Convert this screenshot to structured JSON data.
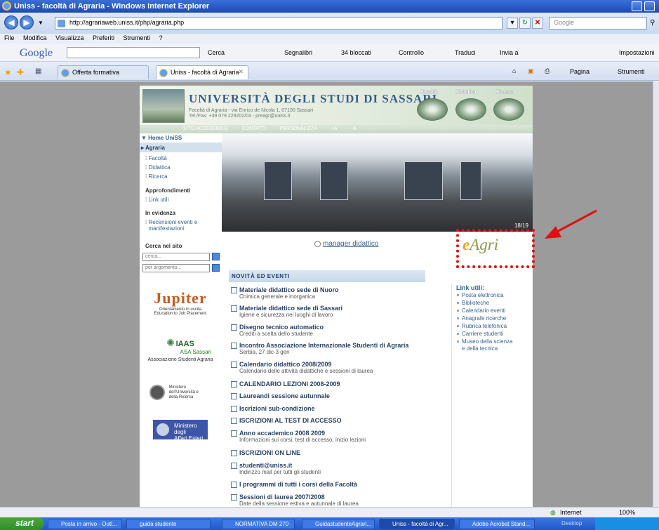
{
  "window": {
    "title": "Uniss - facoltà di Agraria - Windows Internet Explorer"
  },
  "address": {
    "url": "http://agrariaweb.uniss.it/php/agraria.php",
    "search_placeholder": "Google"
  },
  "menu": [
    "File",
    "Modifica",
    "Visualizza",
    "Preferiti",
    "Strumenti",
    "?"
  ],
  "googlebar": {
    "logo": "Google",
    "items": [
      "Cerca",
      "Segnalibri",
      "34 bloccati",
      "Controllo",
      "Traduci",
      "Invia a"
    ],
    "settings": "Impostazioni"
  },
  "tabs": {
    "favorite": "Offerta formativa",
    "active": "Uniss - facoltà di Agraria"
  },
  "commandbar": {
    "page": "Pagina",
    "tools": "Strumenti"
  },
  "site": {
    "university": "UNIVERSITÀ DEGLI STUDI DI SASSARI",
    "faculty_line1": "Facoltà di Agraria - via Enrico de Nicola 1, 07100 Sassari",
    "faculty_line2": "Tel./Fax: +39 079 229202/03 - preagr@uniss.it",
    "top_nav": [
      "Facoltà",
      "Didattica",
      "Ricerca"
    ],
    "access_bar": [
      "SITO ACCESSIBILE",
      "CONTATTI",
      "PERSONALIZZA",
      "+A",
      "-A"
    ],
    "sidebar": {
      "home": "Home UniSS",
      "agraria": "Agraria",
      "items": [
        "Facoltà",
        "Didattica",
        "Ricerca"
      ],
      "approf_head": "Approfondimenti",
      "approf_items": [
        "Link utili"
      ],
      "evidenza_head": "In evidenza",
      "evidenza_items": [
        "Recensioni eventi e",
        "manifestazioni"
      ],
      "search_head": "Cerca nel sito",
      "search_value": "cerca...",
      "keyword_value": "per argomento..."
    },
    "logos": {
      "jupiter": "Jupiter",
      "jupiter_sub1": "Orientamento in uscita",
      "jupiter_sub2": "Education to Job Placement",
      "iaas": "IAAS",
      "iaas_sub": "ASA Sassari",
      "iaas_caption": "Associazione Studenti Agraria",
      "miur": [
        "Ministero",
        "dell'Università e",
        "della Ricerca"
      ],
      "mae": [
        "Ministero degli",
        "Affari Esteri"
      ]
    },
    "slideshow_counter": "18/19",
    "manager_link": "manager didattico",
    "eagri_e": "e",
    "eagri_rest": "Agri",
    "news_head": "NOVITÀ ED EVENTI",
    "news": [
      {
        "title": "Materiale didattico sede di Nuoro",
        "sub": "Chimica generale e inorganica"
      },
      {
        "title": "Materiale didattico sede di Sassari",
        "sub": "Igiene e sicurezza nei luoghi di lavoro"
      },
      {
        "title": "Disegno tecnico automatico",
        "sub": "Crediti a scelta dello studente"
      },
      {
        "title": "Incontro Associazione Internazionale Studenti di Agraria",
        "sub": "Serbia, 27 dic-3 gen"
      },
      {
        "title": "Calendario didattico 2008/2009",
        "sub": "Calendario delle attività didattiche e sessioni di laurea"
      },
      {
        "title": "CALENDARIO LEZIONI 2008-2009",
        "sub": ""
      },
      {
        "title": "Laureandi sessione autunnale",
        "sub": ""
      },
      {
        "title": "Iscrizioni sub-condizione",
        "sub": ""
      },
      {
        "title": "ISCRIZIONI AL TEST DI ACCESSO",
        "sub": ""
      },
      {
        "title": "Anno accademico 2008 2009",
        "sub": "Informazioni sui corsi, test di accesso, inizio lezioni"
      },
      {
        "title": "ISCRIZIONI ON LINE",
        "sub": ""
      },
      {
        "title": "studenti@uniss.it",
        "sub": "Indirizzo mail per tutti gli studenti"
      },
      {
        "title": "I programmi di tutti i corsi della Facoltà",
        "sub": ""
      },
      {
        "title": "Sessioni di laurea 2007/2008",
        "sub": "Date della sessione estiva e autunnale di laurea"
      }
    ],
    "links_head": "Link utili:",
    "links": [
      "Posta elettronica",
      "Biblioteche",
      "Calendario eventi",
      "Anagrafe ricerche",
      "Rubrica telefonica",
      "Carriere studenti",
      "Museo della scienza",
      "e della tecnica"
    ]
  },
  "status": {
    "zone": "Internet",
    "zoom": "100%"
  },
  "taskbar": {
    "start": "start",
    "buttons": [
      "Posta in arrivo - Outl...",
      "guida studente",
      "NORMATIVA DM 270",
      "GuidastudenteAgrari...",
      "Uniss - facoltà di Agr...",
      "Adobe Acrobat Stand..."
    ],
    "desktop": "Desktop"
  },
  "colors": {
    "annotation": "#e01010",
    "link": "#35618f",
    "news_title": "#263f64"
  }
}
